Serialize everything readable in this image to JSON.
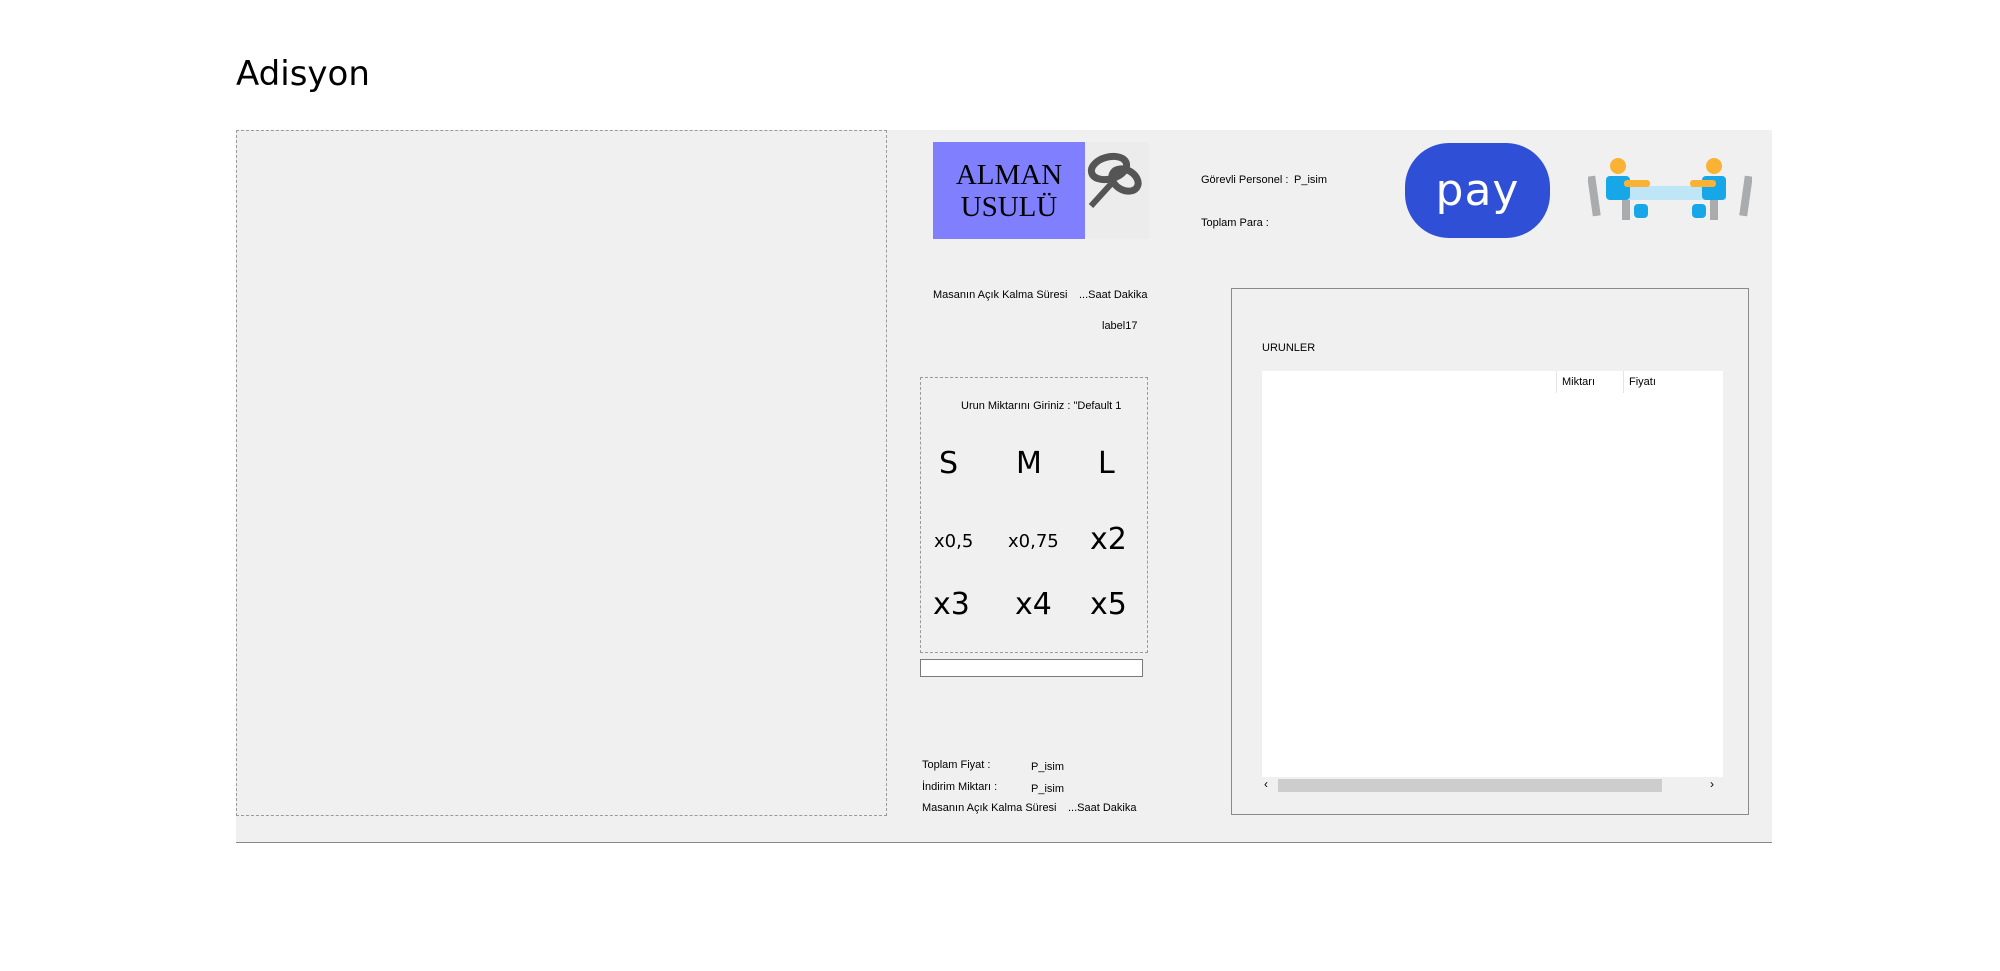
{
  "window_title": "Adisyon",
  "logo": {
    "line1": "ALMAN",
    "line2": "USULÜ"
  },
  "staff": {
    "label": "Görevli Personel :",
    "value": "P_isim"
  },
  "total_money": {
    "label": "Toplam Para :"
  },
  "pay_button": {
    "label": "pay"
  },
  "table_open_time_top": {
    "label": "Masanın Açık Kalma Süresi",
    "value": "...Saat Dakika"
  },
  "label17": "label17",
  "quantity_panel": {
    "prompt": "Urun Miktarını Giriniz : \"Default 1",
    "sizes": [
      "S",
      "M",
      "L"
    ],
    "multipliers_row1": [
      "x0,5",
      "x0,75",
      "x2"
    ],
    "multipliers_row2": [
      "x3",
      "x4",
      "x5"
    ],
    "input_value": ""
  },
  "products": {
    "group_title": "URUNLER",
    "columns": [
      "",
      "Miktarı",
      "Fiyatı"
    ],
    "rows": []
  },
  "summary": {
    "total_price_label": "Toplam Fiyat :",
    "total_price_value": "P_isim",
    "discount_label": "İndirim Miktarı :",
    "discount_value": "P_isim",
    "open_time_label": "Masanın Açık Kalma Süresi",
    "open_time_value": "...Saat Dakika"
  },
  "icons": {
    "logo": "chain-link-logo-icon",
    "table": "restaurant-table-icon",
    "scroll_left": "scroll-left-arrow-icon",
    "scroll_right": "scroll-right-arrow-icon"
  },
  "colors": {
    "form_bg": "#f0f0f0",
    "logo_bg": "#8080ff",
    "pay_bg": "#2f4fd6",
    "table_icon_orange": "#f9b233",
    "table_icon_blue": "#17a6e8",
    "table_icon_gray": "#a9abad"
  }
}
